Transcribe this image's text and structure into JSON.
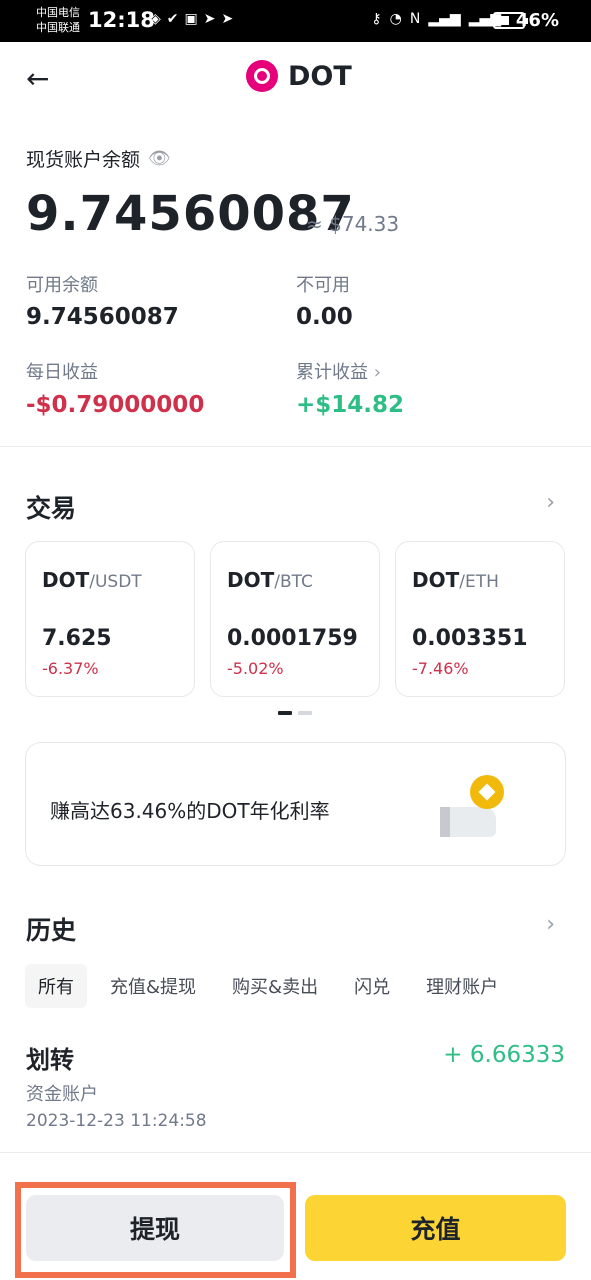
{
  "status_bar": {
    "carrier_1": "中国电信",
    "carrier_2": "中国联通",
    "time": "12:18",
    "battery": "46%",
    "battery_level": 0.46,
    "icons": [
      "nfc-icon",
      "key-icon",
      "speed-icon",
      "signal-icon",
      "wifi-icon",
      "battery-icon"
    ]
  },
  "header": {
    "title": "DOT"
  },
  "balance": {
    "label": "现货账户余额",
    "value": "9.74560087",
    "fiat": "≈ $74.33"
  },
  "stats": {
    "available_label": "可用余额",
    "available_value": "9.74560087",
    "unavailable_label": "不可用",
    "unavailable_value": "0.00",
    "daily_label": "每日收益",
    "daily_value": "-$0.79000000",
    "total_label": "累计收益",
    "total_value": "+$14.82"
  },
  "trade": {
    "title": "交易",
    "pairs": [
      {
        "base": "DOT",
        "quote": "/USDT",
        "price": "7.625",
        "change": "-6.37%"
      },
      {
        "base": "DOT",
        "quote": "/BTC",
        "price": "0.0001759",
        "change": "-5.02%"
      },
      {
        "base": "DOT",
        "quote": "/ETH",
        "price": "0.003351",
        "change": "-7.46%"
      }
    ]
  },
  "promo": {
    "text": "赚高达63.46%的DOT年化利率"
  },
  "history": {
    "title": "历史",
    "tabs": [
      "所有",
      "充值&提现",
      "购买&卖出",
      "闪兑",
      "理财账户"
    ],
    "active_tab": "所有",
    "items": [
      {
        "title": "划转",
        "subtitle": "资金账户",
        "time": "2023-12-23 11:24:58",
        "amount": "+ 6.66333"
      }
    ]
  },
  "actions": {
    "withdraw": "提现",
    "deposit": "充值"
  },
  "colors": {
    "negative": "#cf304a",
    "positive": "#2ebd85",
    "deposit_button": "#fcd535",
    "highlight_frame": "#f2704c",
    "dot_brand": "#e6007a"
  }
}
